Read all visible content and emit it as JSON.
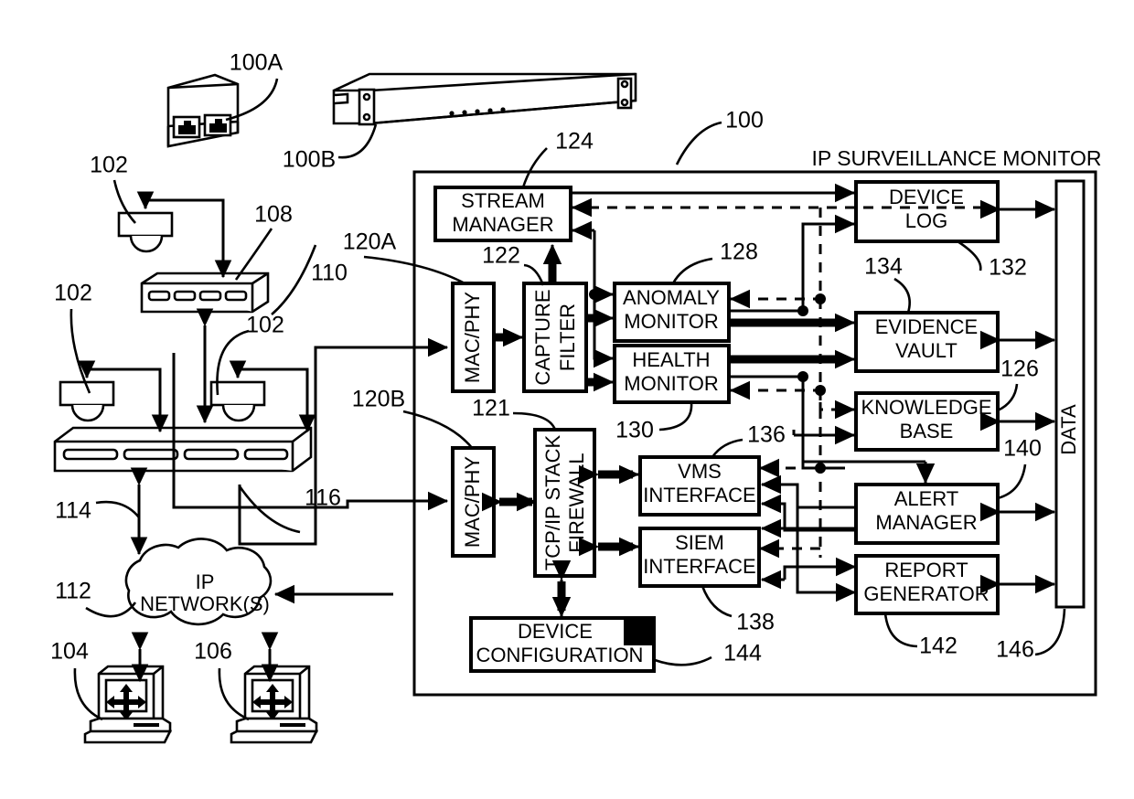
{
  "figure": {
    "title": "IP SURVEILLANCE MONITOR",
    "domain": "patent block diagram"
  },
  "boxes": {
    "stream_manager": {
      "line1": "STREAM",
      "line2": "MANAGER"
    },
    "mac_phy_a": {
      "label": "MAC/PHY"
    },
    "mac_phy_b": {
      "label": "MAC/PHY"
    },
    "capture_filter": {
      "line1": "CAPTURE",
      "line2": "FILTER"
    },
    "anomaly_monitor": {
      "line1": "ANOMALY",
      "line2": "MONITOR"
    },
    "health_monitor": {
      "line1": "HEALTH",
      "line2": "MONITOR"
    },
    "tcpip_firewall": {
      "line1": "TCP/IP STACK",
      "line2": "FIREWALL"
    },
    "vms_interface": {
      "line1": "VMS",
      "line2": "INTERFACE"
    },
    "siem_interface": {
      "line1": "SIEM",
      "line2": "INTERFACE"
    },
    "device_config": {
      "line1": "DEVICE",
      "line2": "CONFIGURATION"
    },
    "device_log": {
      "line1": "DEVICE",
      "line2": "LOG"
    },
    "evidence_vault": {
      "line1": "EVIDENCE",
      "line2": "VAULT"
    },
    "knowledge_base": {
      "line1": "KNOWLEDGE",
      "line2": "BASE"
    },
    "alert_manager": {
      "line1": "ALERT",
      "line2": "MANAGER"
    },
    "report_generator": {
      "line1": "REPORT",
      "line2": "GENERATOR"
    },
    "data_bus": {
      "label": "DATA"
    },
    "ip_network": {
      "line1": "IP",
      "line2": "NETWORK(S)"
    }
  },
  "ref_numbers": {
    "n100": "100",
    "n100A": "100A",
    "n100B": "100B",
    "n102a": "102",
    "n102b": "102",
    "n102c": "102",
    "n104": "104",
    "n106": "106",
    "n108": "108",
    "n110": "110",
    "n112": "112",
    "n114": "114",
    "n116": "116",
    "n120A": "120A",
    "n120B": "120B",
    "n121": "121",
    "n122": "122",
    "n124": "124",
    "n126": "126",
    "n128": "128",
    "n130": "130",
    "n132": "132",
    "n134": "134",
    "n136": "136",
    "n138": "138",
    "n140": "140",
    "n142": "142",
    "n144": "144",
    "n146": "146"
  },
  "devices": {
    "small_appliance": "network-appliance-two-port",
    "rack_appliance": "rack-mount-appliance",
    "cameras": [
      "dome-camera",
      "dome-camera",
      "dome-camera"
    ],
    "switches": [
      "network-switch",
      "network-switch"
    ],
    "workstations": [
      "workstation-computer",
      "workstation-computer"
    ],
    "cloud": "network-cloud"
  },
  "colors": {
    "stroke": "#000000",
    "fill": "#ffffff"
  }
}
